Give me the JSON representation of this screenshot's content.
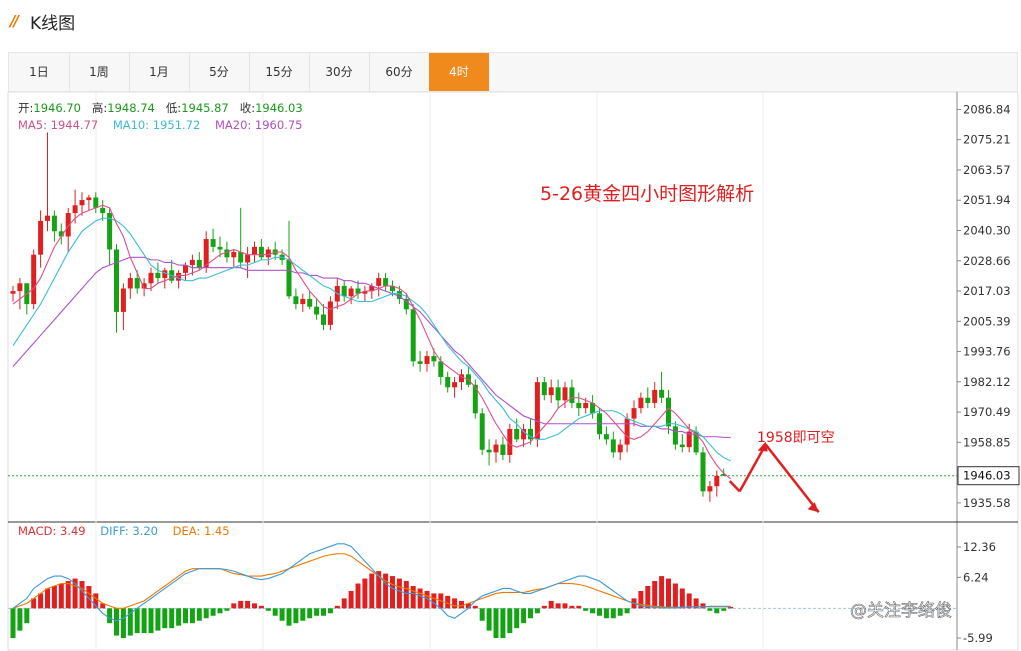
{
  "header": {
    "logo": "//",
    "title": "K线图"
  },
  "tabs": [
    {
      "label": "1日",
      "active": false
    },
    {
      "label": "1周",
      "active": false
    },
    {
      "label": "1月",
      "active": false
    },
    {
      "label": "5分",
      "active": false
    },
    {
      "label": "15分",
      "active": false
    },
    {
      "label": "30分",
      "active": false
    },
    {
      "label": "60分",
      "active": false
    },
    {
      "label": "4时",
      "active": true
    }
  ],
  "ohlc": {
    "open_label": "开:",
    "open": "1946.70",
    "high_label": "高:",
    "high": "1948.74",
    "low_label": "低:",
    "low": "1945.87",
    "close_label": "收:",
    "close": "1946.03"
  },
  "ma": {
    "ma5_label": "MA5:",
    "ma5": "1944.77",
    "ma10_label": "MA10:",
    "ma10": "1951.72",
    "ma20_label": "MA20:",
    "ma20": "1960.75"
  },
  "macd_readout": {
    "macd_label": "MACD:",
    "macd": "3.49",
    "diff_label": "DIFF:",
    "diff": "3.20",
    "dea_label": "DEA:",
    "dea": "1.45"
  },
  "colors": {
    "up": "#e02020",
    "down": "#13a313",
    "ma5": "#e0508a",
    "ma10": "#3cbcd8",
    "ma20": "#b050c8",
    "diff": "#3a9ad8",
    "dea": "#f07800",
    "accent": "#f08a1c",
    "annotation": "#e02020"
  },
  "annotations": {
    "headline": "5-26黄金四小时图形解析",
    "target": "1958即可空"
  },
  "watermark": "@关注李络俊",
  "chart_data": [
    {
      "type": "candlestick",
      "title": "",
      "ylim": [
        1929.0,
        2092.0
      ],
      "ytick_labels": [
        "2086.84",
        "2075.21",
        "2063.57",
        "2051.94",
        "2040.30",
        "2028.66",
        "2017.03",
        "2005.39",
        "1993.76",
        "1982.12",
        "1970.49",
        "1958.85",
        "1935.58"
      ],
      "yticks": [
        2086.84,
        2075.21,
        2063.57,
        2051.94,
        2040.3,
        2028.66,
        2017.03,
        2005.39,
        1993.76,
        1982.12,
        1970.49,
        1958.85,
        1935.58
      ],
      "current_price": "1946.03",
      "current_price_value": 1946.03,
      "candles": [
        [
          2016,
          2019,
          2013,
          2017
        ],
        [
          2017,
          2022,
          2010,
          2020
        ],
        [
          2020,
          2020,
          2008,
          2012
        ],
        [
          2012,
          2033,
          2010,
          2031
        ],
        [
          2031,
          2048,
          2026,
          2044
        ],
        [
          2044,
          2078,
          2040,
          2046
        ],
        [
          2046,
          2048,
          2036,
          2040
        ],
        [
          2040,
          2043,
          2035,
          2038
        ],
        [
          2038,
          2049,
          2032,
          2047
        ],
        [
          2047,
          2056,
          2043,
          2050
        ],
        [
          2050,
          2055,
          2046,
          2052
        ],
        [
          2052,
          2054,
          2048,
          2053
        ],
        [
          2053,
          2055,
          2047,
          2049
        ],
        [
          2049,
          2052,
          2044,
          2047
        ],
        [
          2047,
          2049,
          2027,
          2033
        ],
        [
          2033,
          2035,
          2001,
          2009
        ],
        [
          2009,
          2020,
          2002,
          2018
        ],
        [
          2018,
          2024,
          2014,
          2022
        ],
        [
          2022,
          2025,
          2016,
          2018
        ],
        [
          2018,
          2022,
          2015,
          2020
        ],
        [
          2020,
          2026,
          2017,
          2024
        ],
        [
          2024,
          2028,
          2020,
          2022
        ],
        [
          2022,
          2026,
          2018,
          2025
        ],
        [
          2025,
          2029,
          2020,
          2021
        ],
        [
          2021,
          2025,
          2018,
          2024
        ],
        [
          2024,
          2028,
          2021,
          2027
        ],
        [
          2027,
          2031,
          2023,
          2029
        ],
        [
          2029,
          2032,
          2025,
          2026
        ],
        [
          2026,
          2040,
          2024,
          2037
        ],
        [
          2037,
          2041,
          2032,
          2034
        ],
        [
          2034,
          2038,
          2030,
          2033
        ],
        [
          2033,
          2036,
          2028,
          2030
        ],
        [
          2030,
          2033,
          2026,
          2032
        ],
        [
          2032,
          2049,
          2026,
          2028
        ],
        [
          2028,
          2034,
          2022,
          2031
        ],
        [
          2031,
          2036,
          2028,
          2034
        ],
        [
          2034,
          2037,
          2029,
          2030
        ],
        [
          2030,
          2034,
          2027,
          2033
        ],
        [
          2033,
          2036,
          2029,
          2031
        ],
        [
          2031,
          2033,
          2027,
          2029
        ],
        [
          2029,
          2044,
          2014,
          2015
        ],
        [
          2015,
          2018,
          2010,
          2012
        ],
        [
          2012,
          2016,
          2009,
          2014
        ],
        [
          2014,
          2017,
          2010,
          2011
        ],
        [
          2011,
          2014,
          2006,
          2008
        ],
        [
          2008,
          2012,
          2002,
          2004
        ],
        [
          2004,
          2015,
          2002,
          2013
        ],
        [
          2013,
          2022,
          2010,
          2019
        ],
        [
          2019,
          2021,
          2013,
          2015
        ],
        [
          2015,
          2019,
          2012,
          2018
        ],
        [
          2018,
          2021,
          2014,
          2016
        ],
        [
          2016,
          2019,
          2013,
          2017
        ],
        [
          2017,
          2020,
          2014,
          2019
        ],
        [
          2019,
          2024,
          2015,
          2022
        ],
        [
          2022,
          2024,
          2017,
          2019
        ],
        [
          2019,
          2021,
          2015,
          2017
        ],
        [
          2017,
          2019,
          2012,
          2014
        ],
        [
          2014,
          2016,
          2008,
          2010
        ],
        [
          2010,
          2012,
          1988,
          1990
        ],
        [
          1990,
          1994,
          1986,
          1989
        ],
        [
          1989,
          1994,
          1986,
          1992
        ],
        [
          1992,
          1995,
          1988,
          1990
        ],
        [
          1990,
          1992,
          1981,
          1984
        ],
        [
          1984,
          1986,
          1978,
          1980
        ],
        [
          1980,
          1984,
          1976,
          1982
        ],
        [
          1982,
          1987,
          1979,
          1985
        ],
        [
          1985,
          1988,
          1980,
          1981
        ],
        [
          1981,
          1983,
          1968,
          1970
        ],
        [
          1970,
          1972,
          1954,
          1956
        ],
        [
          1956,
          1960,
          1950,
          1955
        ],
        [
          1955,
          1960,
          1951,
          1958
        ],
        [
          1958,
          1961,
          1952,
          1954
        ],
        [
          1954,
          1966,
          1951,
          1964
        ],
        [
          1964,
          1968,
          1959,
          1960
        ],
        [
          1960,
          1966,
          1957,
          1964
        ],
        [
          1964,
          1968,
          1958,
          1960
        ],
        [
          1960,
          1984,
          1957,
          1982
        ],
        [
          1982,
          1984,
          1975,
          1977
        ],
        [
          1977,
          1983,
          1974,
          1980
        ],
        [
          1980,
          1983,
          1972,
          1975
        ],
        [
          1975,
          1982,
          1972,
          1980
        ],
        [
          1980,
          1983,
          1972,
          1974
        ],
        [
          1974,
          1978,
          1969,
          1972
        ],
        [
          1972,
          1976,
          1970,
          1974
        ],
        [
          1974,
          1977,
          1968,
          1970
        ],
        [
          1970,
          1972,
          1960,
          1962
        ],
        [
          1962,
          1965,
          1958,
          1960
        ],
        [
          1960,
          1963,
          1953,
          1955
        ],
        [
          1955,
          1960,
          1952,
          1958
        ],
        [
          1958,
          1970,
          1955,
          1968
        ],
        [
          1968,
          1975,
          1965,
          1972
        ],
        [
          1972,
          1978,
          1970,
          1976
        ],
        [
          1976,
          1980,
          1972,
          1974
        ],
        [
          1974,
          1982,
          1972,
          1979
        ],
        [
          1979,
          1986,
          1974,
          1976
        ],
        [
          1976,
          1979,
          1962,
          1965
        ],
        [
          1965,
          1967,
          1956,
          1958
        ],
        [
          1958,
          1962,
          1955,
          1957
        ],
        [
          1957,
          1966,
          1955,
          1963
        ],
        [
          1963,
          1965,
          1954,
          1955
        ],
        [
          1955,
          1957,
          1938,
          1940
        ],
        [
          1940,
          1944,
          1936,
          1942
        ],
        [
          1942,
          1948,
          1938,
          1946
        ],
        [
          1946.7,
          1948.74,
          1945.87,
          1946.03
        ]
      ],
      "ma5": [
        2012,
        2014,
        2016,
        2018,
        2022,
        2028,
        2034,
        2038,
        2042,
        2045,
        2047,
        2048,
        2049,
        2050,
        2049,
        2043,
        2038,
        2030,
        2024,
        2018,
        2018,
        2020,
        2021,
        2022,
        2023,
        2023,
        2024,
        2025,
        2027,
        2029,
        2031,
        2032,
        2033,
        2032,
        2031,
        2031,
        2031,
        2031,
        2032,
        2032,
        2030,
        2025,
        2021,
        2017,
        2014,
        2011,
        2010,
        2011,
        2012,
        2014,
        2016,
        2017,
        2017,
        2018,
        2019,
        2019,
        2018,
        2016,
        2011,
        2006,
        2000,
        1994,
        1990,
        1988,
        1986,
        1984,
        1983,
        1980,
        1976,
        1971,
        1966,
        1962,
        1958,
        1957,
        1958,
        1959,
        1962,
        1965,
        1968,
        1972,
        1974,
        1976,
        1976,
        1975,
        1974,
        1972,
        1970,
        1967,
        1964,
        1961,
        1960,
        1961,
        1963,
        1966,
        1969,
        1972,
        1970,
        1967,
        1964,
        1962,
        1959,
        1954,
        1950,
        1947,
        1944.77
      ],
      "ma10": [
        1996,
        2000,
        2004,
        2008,
        2012,
        2017,
        2022,
        2027,
        2032,
        2036,
        2040,
        2042,
        2044,
        2045,
        2045,
        2044,
        2042,
        2039,
        2035,
        2031,
        2027,
        2025,
        2024,
        2023,
        2022,
        2021,
        2021,
        2022,
        2022,
        2023,
        2024,
        2025,
        2026,
        2027,
        2027,
        2028,
        2029,
        2029,
        2030,
        2030,
        2029,
        2027,
        2025,
        2023,
        2021,
        2019,
        2018,
        2016,
        2015,
        2014,
        2013,
        2013,
        2013,
        2014,
        2015,
        2016,
        2016,
        2015,
        2013,
        2011,
        2008,
        2004,
        2000,
        1996,
        1993,
        1990,
        1988,
        1985,
        1982,
        1978,
        1975,
        1972,
        1968,
        1966,
        1963,
        1961,
        1960,
        1960,
        1961,
        1962,
        1964,
        1966,
        1968,
        1969,
        1970,
        1971,
        1971,
        1971,
        1970,
        1968,
        1967,
        1966,
        1965,
        1965,
        1965,
        1966,
        1966,
        1965,
        1964,
        1963,
        1961,
        1958,
        1955,
        1953,
        1951.72
      ],
      "ma20": [
        1988,
        1991,
        1994,
        1997,
        2000,
        2003,
        2006,
        2009,
        2012,
        2015,
        2018,
        2021,
        2024,
        2026,
        2027,
        2028,
        2029,
        2030,
        2030,
        2030,
        2029,
        2029,
        2028,
        2028,
        2027,
        2027,
        2026,
        2026,
        2026,
        2026,
        2026,
        2026,
        2026,
        2026,
        2025,
        2025,
        2025,
        2025,
        2025,
        2025,
        2025,
        2024,
        2024,
        2023,
        2023,
        2022,
        2022,
        2022,
        2021,
        2021,
        2020,
        2020,
        2019,
        2018,
        2017,
        2016,
        2015,
        2013,
        2011,
        2009,
        2006,
        2003,
        2000,
        1997,
        1994,
        1992,
        1989,
        1986,
        1983,
        1980,
        1977,
        1975,
        1973,
        1971,
        1969,
        1968,
        1967,
        1966,
        1966,
        1966,
        1966,
        1966,
        1966,
        1966,
        1966,
        1966,
        1966,
        1966,
        1966,
        1966,
        1966,
        1965,
        1965,
        1965,
        1964,
        1964,
        1963,
        1963,
        1962,
        1962,
        1961,
        1961,
        1961,
        1960.8,
        1960.75
      ]
    },
    {
      "type": "macd",
      "ylim": [
        -8.0,
        17.0
      ],
      "ytick_labels": [
        "12.36",
        "6.24",
        "-5.99"
      ],
      "yticks": [
        12.36,
        6.24,
        -5.99
      ],
      "zero_line": 0,
      "hist": [
        -6,
        -4.5,
        -3,
        2,
        3,
        4,
        4.5,
        5,
        5.5,
        6,
        5.5,
        4.5,
        3,
        1,
        -3,
        -5.5,
        -6,
        -5.5,
        -5,
        -5,
        -5,
        -4.5,
        -4,
        -4,
        -3.5,
        -3,
        -3,
        -2.5,
        -2,
        -1.5,
        -1,
        -0.5,
        1,
        1.5,
        1.5,
        1,
        0.5,
        -0.5,
        -1.5,
        -2.5,
        -3.5,
        -3,
        -2.5,
        -2,
        -1.5,
        -1.5,
        -1,
        0.5,
        2,
        3.5,
        5,
        6,
        7,
        7.5,
        7,
        6.5,
        6,
        5.5,
        4.5,
        4,
        3.5,
        3,
        3,
        2.5,
        2,
        1.5,
        1,
        0.5,
        -2.5,
        -4.5,
        -6,
        -6,
        -5,
        -4,
        -3,
        -2,
        -1,
        0.5,
        1.5,
        1,
        1,
        0.5,
        0.5,
        -0.5,
        -1,
        -1.5,
        -2,
        -2,
        -1.5,
        -1,
        2,
        3.5,
        4.5,
        5.5,
        6.5,
        6,
        5,
        4,
        3,
        2,
        1,
        -0.5,
        -1,
        -0.5,
        0.3
      ],
      "diff": [
        0,
        1,
        2,
        4,
        5,
        6,
        6.5,
        6.5,
        6,
        5,
        3.5,
        2,
        0.5,
        -1,
        -2,
        -2.5,
        -2,
        -1,
        0,
        1,
        2,
        3,
        4,
        5,
        6,
        7,
        7.5,
        8,
        8,
        8,
        8,
        7.8,
        7.5,
        7,
        6.5,
        6,
        5.8,
        6,
        6.5,
        7,
        8,
        9,
        10,
        11,
        11.5,
        12,
        12.5,
        13,
        13,
        12.5,
        11,
        9.5,
        8,
        6.5,
        5,
        4,
        3.5,
        3,
        3,
        2.5,
        2,
        1,
        0,
        -1.5,
        -2,
        -1,
        0,
        1.5,
        2.5,
        3,
        3.5,
        4,
        4,
        3.5,
        3,
        3,
        3.5,
        4,
        4.5,
        5,
        5.5,
        6,
        6.5,
        6.5,
        6,
        5.5,
        4.5,
        3.5,
        2.5,
        1.5,
        1,
        0.5,
        0.3,
        0.2,
        0.1,
        0.1,
        0.1,
        0.2,
        0.3,
        0.3,
        0.3,
        0.4,
        0.4,
        0.4,
        0.4
      ],
      "dea": [
        0,
        0.5,
        1,
        2,
        3,
        4,
        4.5,
        5,
        5,
        4.5,
        4,
        3,
        2,
        1,
        0.5,
        0,
        0,
        0.5,
        1,
        1.5,
        2.5,
        3.5,
        4.5,
        5.5,
        6.5,
        7.5,
        8,
        8,
        8,
        8,
        8,
        7.5,
        7,
        6.8,
        6.5,
        6.5,
        6.5,
        6.8,
        7,
        7.5,
        8,
        8.5,
        9,
        9.5,
        10,
        10.5,
        10.8,
        11,
        11,
        10.5,
        9.5,
        8.5,
        7.5,
        6.5,
        5.5,
        4.8,
        4.3,
        4,
        3.5,
        3,
        2.5,
        2,
        1.5,
        1,
        0.5,
        0.5,
        1,
        1.5,
        2,
        2.5,
        3,
        3.2,
        3.2,
        3.2,
        3.2,
        3.5,
        3.8,
        4,
        4.5,
        5,
        5,
        5,
        4.8,
        4.5,
        4,
        3.5,
        3,
        2.5,
        2,
        1.5,
        1,
        0.8,
        0.6,
        0.4,
        0.3,
        0.2,
        0.2,
        0.2,
        0.3,
        0.3,
        0.3,
        0.3,
        0.3,
        0.3,
        0.3
      ]
    }
  ]
}
